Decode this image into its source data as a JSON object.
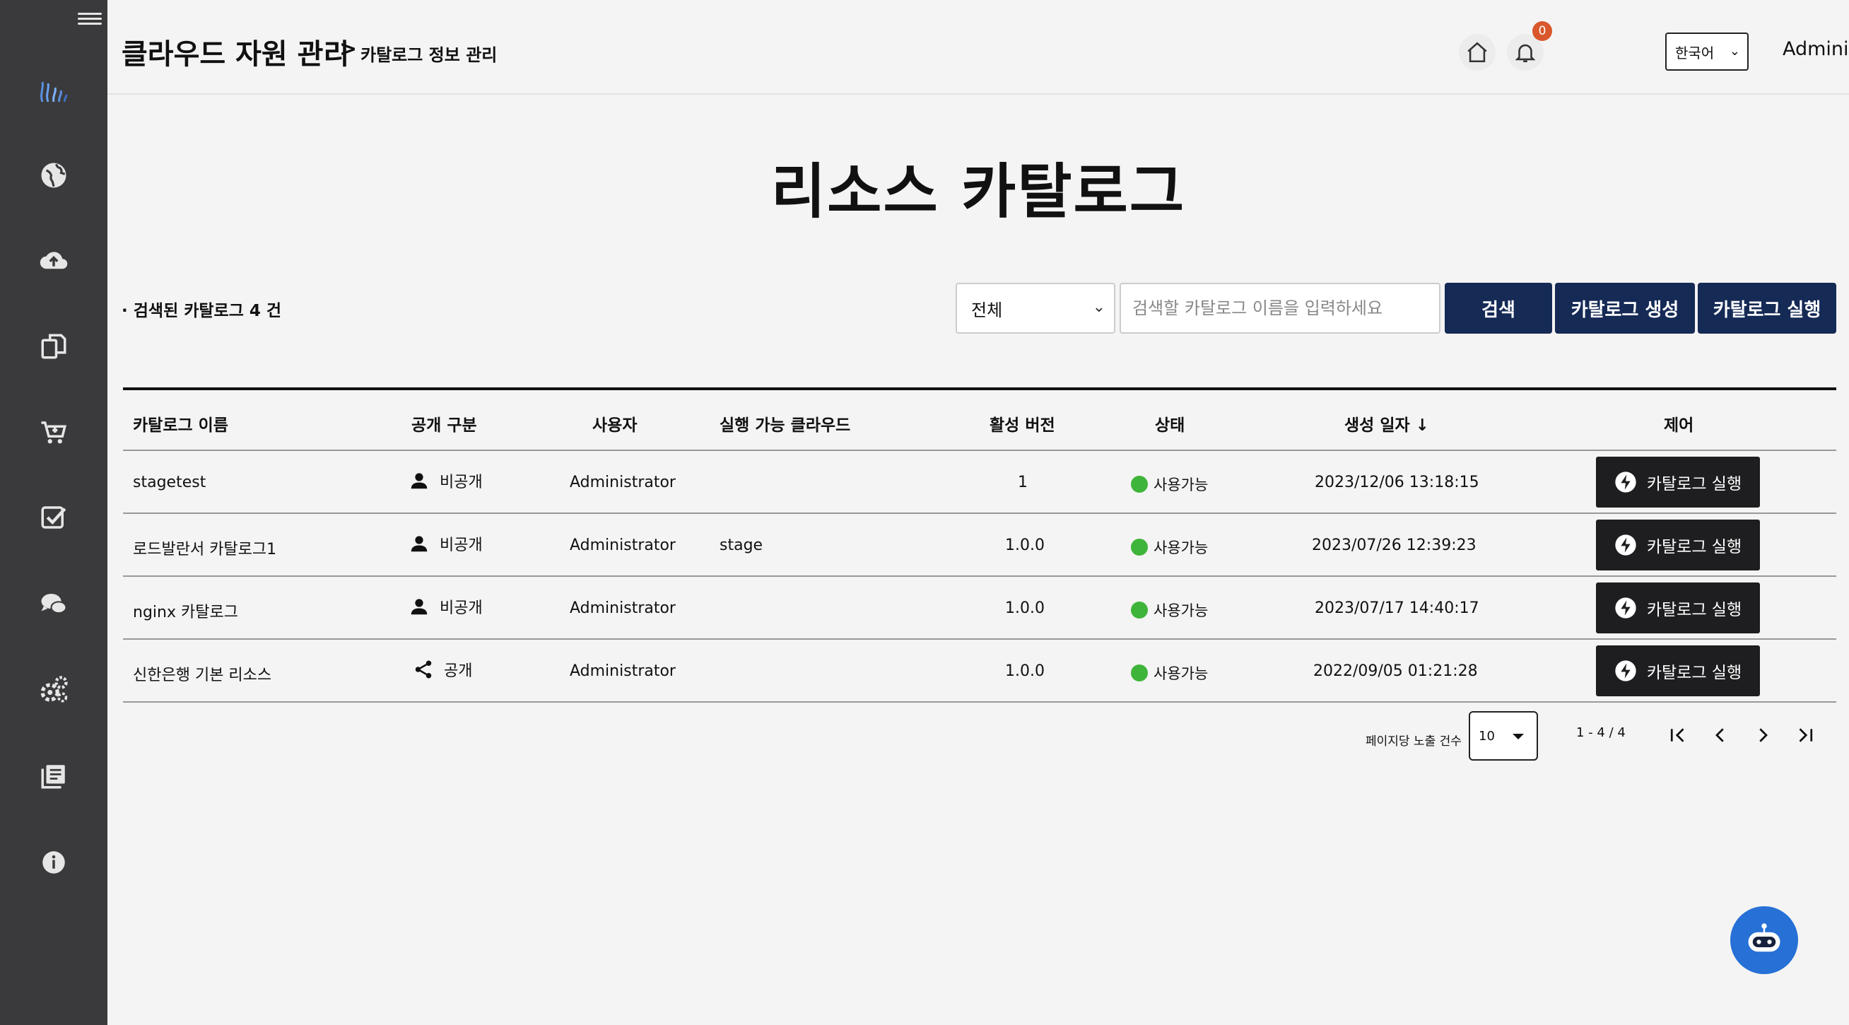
{
  "sidebar": {
    "items": [
      {
        "icon": "globe-icon"
      },
      {
        "icon": "cloud-upload-icon"
      },
      {
        "icon": "copy-icon"
      },
      {
        "icon": "cart-icon"
      },
      {
        "icon": "checkbox-icon"
      },
      {
        "icon": "chat-icon"
      },
      {
        "icon": "settings-icon"
      },
      {
        "icon": "library-icon"
      },
      {
        "icon": "info-icon"
      }
    ]
  },
  "header": {
    "title": "클라우드 자원 관리",
    "separator": ">",
    "subtitle": "카탈로그 정보 관리",
    "notification_count": "0",
    "language": "한국어",
    "user": "Administrator"
  },
  "main": {
    "page_title": "리소스 카탈로그",
    "result_count": "· 검색된 카탈로그 4 건",
    "filter": {
      "selected": "전체"
    },
    "search": {
      "placeholder": "검색할 카탈로그 이름을 입력하세요",
      "button": "검색"
    },
    "create_button": "카탈로그 생성",
    "run_button": "카탈로그 실행"
  },
  "table": {
    "columns": [
      "카탈로그 이름",
      "공개 구분",
      "사용자",
      "실행 가능 클라우드",
      "활성 버전",
      "상태",
      "생성 일자 ↓",
      "제어"
    ],
    "rows": [
      {
        "name": "stagetest",
        "visibility": "비공개",
        "visibility_icon": "person-icon",
        "user": "Administrator",
        "cloud": "",
        "version": "1",
        "status": "사용가능",
        "created": "2023/12/06 13:18:15",
        "action": "카탈로그 실행"
      },
      {
        "name": "로드발란서 카탈로그1",
        "visibility": "비공개",
        "visibility_icon": "person-icon",
        "user": "Administrator",
        "cloud": "stage",
        "version": "1.0.0",
        "status": "사용가능",
        "created": "2023/07/26 12:39:23",
        "action": "카탈로그 실행"
      },
      {
        "name": "nginx 카탈로그",
        "visibility": "비공개",
        "visibility_icon": "person-icon",
        "user": "Administrator",
        "cloud": "",
        "version": "1.0.0",
        "status": "사용가능",
        "created": "2023/07/17 14:40:17",
        "action": "카탈로그 실행"
      },
      {
        "name": "신한은행 기본 리소스",
        "visibility": "공개",
        "visibility_icon": "share-icon",
        "user": "Administrator",
        "cloud": "",
        "version": "1.0.0",
        "status": "사용가능",
        "created": "2022/09/05 01:21:28",
        "action": "카탈로그 실행"
      }
    ]
  },
  "pagination": {
    "rows_label": "페이지당 노출 건수",
    "rows_per_page": "10",
    "range": "1 - 4 / 4"
  },
  "colors": {
    "sidebar_bg": "#3a3a3c",
    "primary_navy": "#152a55",
    "run_button_bg": "#1e1e20",
    "status_green": "#3fb43a",
    "badge_orange": "#d9572c",
    "chatbot_blue": "#2670d6"
  }
}
